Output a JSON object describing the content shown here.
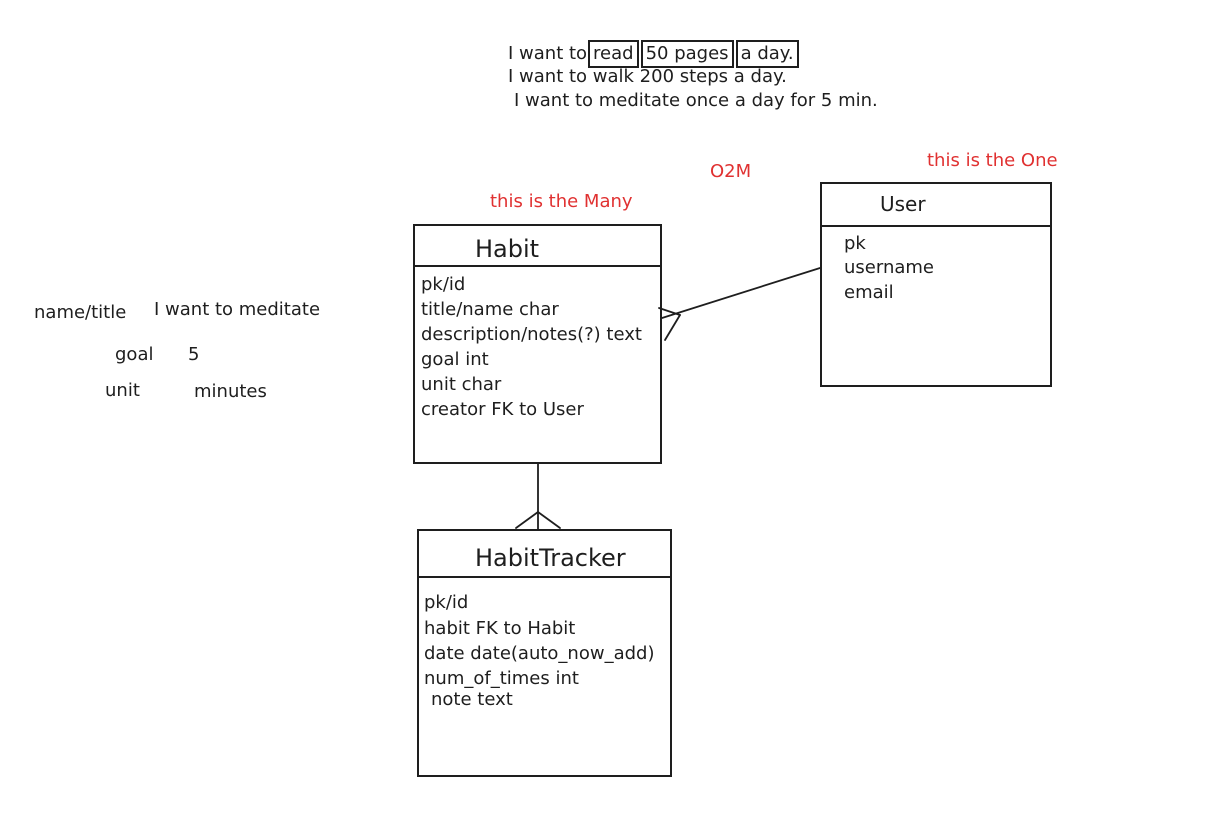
{
  "goals": {
    "line1_prefix": "I want to",
    "line1_read": "read",
    "line1_pages": "50 pages",
    "line1_day": "a day.",
    "line2": "I want to walk 200 steps a day.",
    "line3": "I want to meditate once a day for 5 min."
  },
  "annotations": {
    "o2m": "O2M",
    "one": "this is the One",
    "many": "this is the Many"
  },
  "example": {
    "name_label": "name/title",
    "name_value": "I want to meditate",
    "goal_label": "goal",
    "goal_value": "5",
    "unit_label": "unit",
    "unit_value": "minutes"
  },
  "entities": {
    "habit": {
      "title": "Habit",
      "fields": [
        "pk/id",
        "title/name char",
        "description/notes(?) text",
        "goal int",
        "unit char",
        "creator FK to User"
      ]
    },
    "user": {
      "title": "User",
      "fields": [
        "pk",
        "username",
        "email"
      ]
    },
    "habit_tracker": {
      "title": "HabitTracker",
      "fields": [
        "pk/id",
        "habit FK to Habit",
        "date date(auto_now_add)",
        "num_of_times int",
        "note text"
      ]
    }
  },
  "colors": {
    "ink": "#1e1e1e",
    "accent_red": "#e03131",
    "background": "#ffffff"
  }
}
